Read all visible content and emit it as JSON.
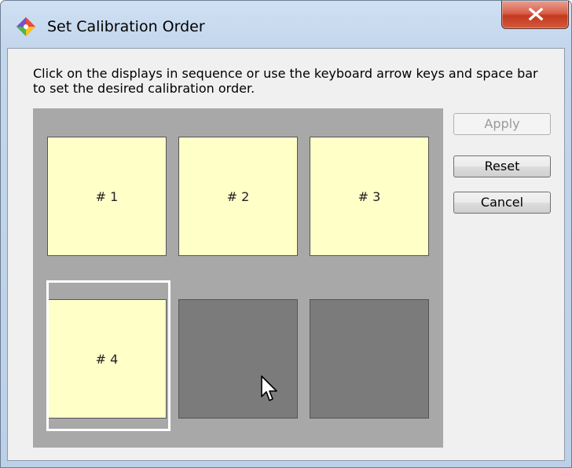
{
  "window": {
    "title": "Set Calibration Order",
    "icon": "calibration-app-icon",
    "close_icon": "close-icon"
  },
  "instructions": "Click on the displays in sequence or use the keyboard arrow keys and space bar to set the desired calibration order.",
  "displays": [
    {
      "label": "# 1",
      "state": "assigned"
    },
    {
      "label": "# 2",
      "state": "assigned"
    },
    {
      "label": "# 3",
      "state": "assigned"
    },
    {
      "label": "# 4",
      "state": "assigned",
      "selected": true
    },
    {
      "label": "",
      "state": "unassigned"
    },
    {
      "label": "",
      "state": "unassigned"
    }
  ],
  "buttons": {
    "apply": {
      "label": "Apply",
      "enabled": false
    },
    "reset": {
      "label": "Reset",
      "enabled": true
    },
    "cancel": {
      "label": "Cancel",
      "enabled": true
    }
  },
  "colors": {
    "assigned_display": "#ffffc8",
    "unassigned_display": "#7b7b7b",
    "panel_background": "#a8a8a8",
    "selection_outline": "#ffffff",
    "close_button": "#c3391f"
  }
}
